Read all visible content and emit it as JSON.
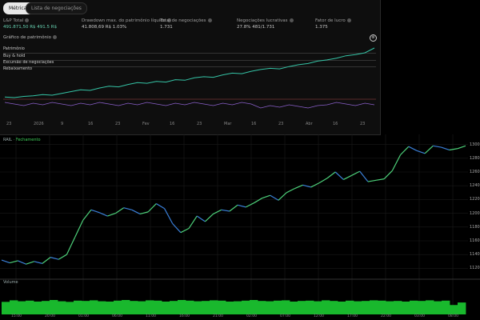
{
  "tabs": [
    {
      "label": "Métricas",
      "active": true
    },
    {
      "label": "Lista de negociações",
      "active": false
    }
  ],
  "stats": [
    {
      "label": "L&P Total",
      "value": "491.871,50 R$ 491.5 R$"
    },
    {
      "label": "Drawdown max. do patrimônio líquido",
      "value": "41.808,69 R$ 1.03%"
    },
    {
      "label": "Total de negociações",
      "value": "1.731"
    },
    {
      "label": "Negociações lucrativas",
      "value": "27.8% 481/1.731"
    },
    {
      "label": "Fator de lucro",
      "value": "1.375"
    }
  ],
  "equity_title": "Gráfico de patrimônio",
  "legend": [
    "Patrimônio",
    "Buy & hold",
    "Excursão de negociações",
    "Rebaixamento"
  ],
  "top_x_ticks": [
    "23",
    "2026",
    "9",
    "16",
    "23",
    "Fev",
    "16",
    "23",
    "Mar",
    "16",
    "23",
    "Abr",
    "16",
    "23"
  ],
  "bottom_chart_label": {
    "symbol": "RAIL",
    "suffix": "·  Fechamento"
  },
  "bottom_y_ticks": [
    "1300",
    "1280",
    "1260",
    "1240",
    "1220",
    "1200",
    "1180",
    "1160",
    "1140",
    "1120"
  ],
  "volume_label": "Volume",
  "bottom_x_ticks": [
    "15:00",
    "20:00",
    "01:00",
    "06:00",
    "11:00",
    "16:00",
    "21:00",
    "02:00",
    "07:00",
    "12:00",
    "17:00",
    "22:00",
    "03:00",
    "08:00"
  ],
  "colors": {
    "equity": "#35c4a6",
    "price_up": "#4dd17a",
    "price_down": "#3a7fd8",
    "volume": "#19b82d",
    "drawdown": "#8a5fc9"
  },
  "chart_data": {
    "type": "line",
    "series": [
      {
        "name": "Patrimônio",
        "values": [
          18,
          17,
          19,
          20,
          22,
          21,
          24,
          27,
          30,
          29,
          33,
          36,
          35,
          39,
          42,
          41,
          44,
          43,
          47,
          46,
          50,
          52,
          51,
          55,
          58,
          57,
          61,
          64,
          66,
          65,
          69,
          72,
          74,
          78,
          80,
          83,
          87,
          89,
          92,
          100
        ]
      }
    ],
    "price": [
      1132,
      1128,
      1131,
      1126,
      1130,
      1127,
      1136,
      1133,
      1140,
      1165,
      1190,
      1205,
      1201,
      1196,
      1200,
      1208,
      1205,
      1199,
      1202,
      1214,
      1207,
      1185,
      1172,
      1178,
      1196,
      1188,
      1199,
      1205,
      1203,
      1212,
      1209,
      1215,
      1222,
      1226,
      1219,
      1230,
      1236,
      1241,
      1238,
      1244,
      1251,
      1260,
      1249,
      1255,
      1261,
      1246,
      1248,
      1250,
      1262,
      1285,
      1297,
      1291,
      1287,
      1298,
      1296,
      1292,
      1294,
      1298
    ],
    "volume": [
      40,
      45,
      42,
      44,
      41,
      43,
      46,
      42,
      40,
      44,
      43,
      45,
      42,
      41,
      44,
      46,
      43,
      42,
      45,
      44,
      41,
      43,
      46,
      44,
      42,
      43,
      45,
      44,
      41,
      42,
      44,
      46,
      43,
      42,
      44,
      45,
      41,
      43,
      44,
      42,
      45,
      43,
      41,
      44,
      42,
      43,
      45,
      44,
      42,
      43,
      41,
      44,
      43,
      45,
      42,
      44,
      30,
      38
    ],
    "ylim": [
      1110,
      1310
    ],
    "grid": true
  }
}
